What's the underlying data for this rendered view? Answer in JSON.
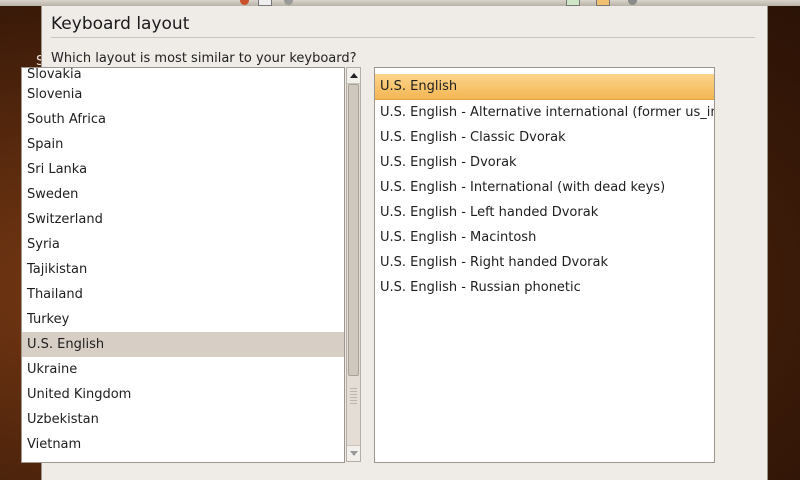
{
  "window": {
    "title": "Keyboard layout",
    "question": "Which layout is most similar to your keyboard?"
  },
  "background": {
    "left_fragments": [
      "S",
      "S"
    ]
  },
  "countries": {
    "selected": "U.S. English",
    "items": [
      "Slovakia",
      "Slovenia",
      "South Africa",
      "Spain",
      "Sri Lanka",
      "Sweden",
      "Switzerland",
      "Syria",
      "Tajikistan",
      "Thailand",
      "Turkey",
      "U.S. English",
      "Ukraine",
      "United Kingdom",
      "Uzbekistan",
      "Vietnam"
    ]
  },
  "scrollbar": {
    "up_icon": "arrow-up-icon",
    "down_icon": "arrow-down-icon"
  },
  "variants": {
    "selected": "U.S. English",
    "items": [
      "U.S. English",
      "U.S. English - Alternative international (former us_intl)",
      "U.S. English - Classic Dvorak",
      "U.S. English - Dvorak",
      "U.S. English - International (with dead keys)",
      "U.S. English - Left handed Dvorak",
      "U.S. English - Macintosh",
      "U.S. English - Right handed Dvorak",
      "U.S. English - Russian phonetic"
    ]
  },
  "colors": {
    "selection_accent": "#f4b653",
    "list_selection": "#d7cfc6",
    "window_bg": "#efebe7"
  }
}
